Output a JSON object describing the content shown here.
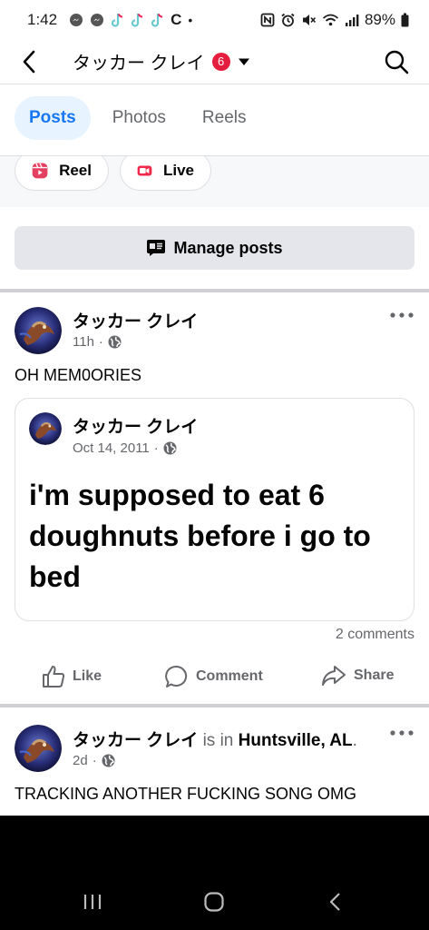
{
  "status_bar": {
    "time": "1:42",
    "left_icons": [
      "messenger-icon",
      "messenger-icon",
      "tiktok-icon",
      "tiktok-icon",
      "tiktok-icon",
      "c-app-icon",
      "dot-icon"
    ],
    "c_glyph": "C",
    "dot_glyph": "•",
    "right_icons": [
      "nfc-icon",
      "alarm-icon",
      "mute-icon",
      "wifi-icon",
      "signal-icon"
    ],
    "battery": "89%"
  },
  "header": {
    "title": "タッカー クレイ",
    "badge": "6"
  },
  "tabs": [
    {
      "label": "Posts",
      "active": true
    },
    {
      "label": "Photos",
      "active": false
    },
    {
      "label": "Reels",
      "active": false
    }
  ],
  "create": {
    "reel_label": "Reel",
    "live_label": "Live"
  },
  "manage": {
    "label": "Manage posts"
  },
  "post1": {
    "author": "タッカー クレイ",
    "time": "11h",
    "sep": "·",
    "text": "OH MEM0ORIES",
    "shared": {
      "author": "タッカー クレイ",
      "date": "Oct 14, 2011",
      "sep": "·",
      "text": "i'm supposed to eat 6 doughnuts before i go to bed"
    },
    "comments": "2 comments",
    "actions": {
      "like": "Like",
      "comment": "Comment",
      "share": "Share"
    }
  },
  "post2": {
    "author": "タッカー クレイ",
    "is_in": "is in",
    "location": "Huntsville, AL",
    "location_end": ".",
    "time": "2d",
    "sep": "·",
    "text": "TRACKING ANOTHER FUCKING SONG OMG"
  },
  "colors": {
    "accent": "#1877f2",
    "tab_active_bg": "#e7f3ff",
    "badge": "#e41e3f",
    "muted_text": "#65676b",
    "reel": "#e4405f",
    "live": "#f02849"
  }
}
